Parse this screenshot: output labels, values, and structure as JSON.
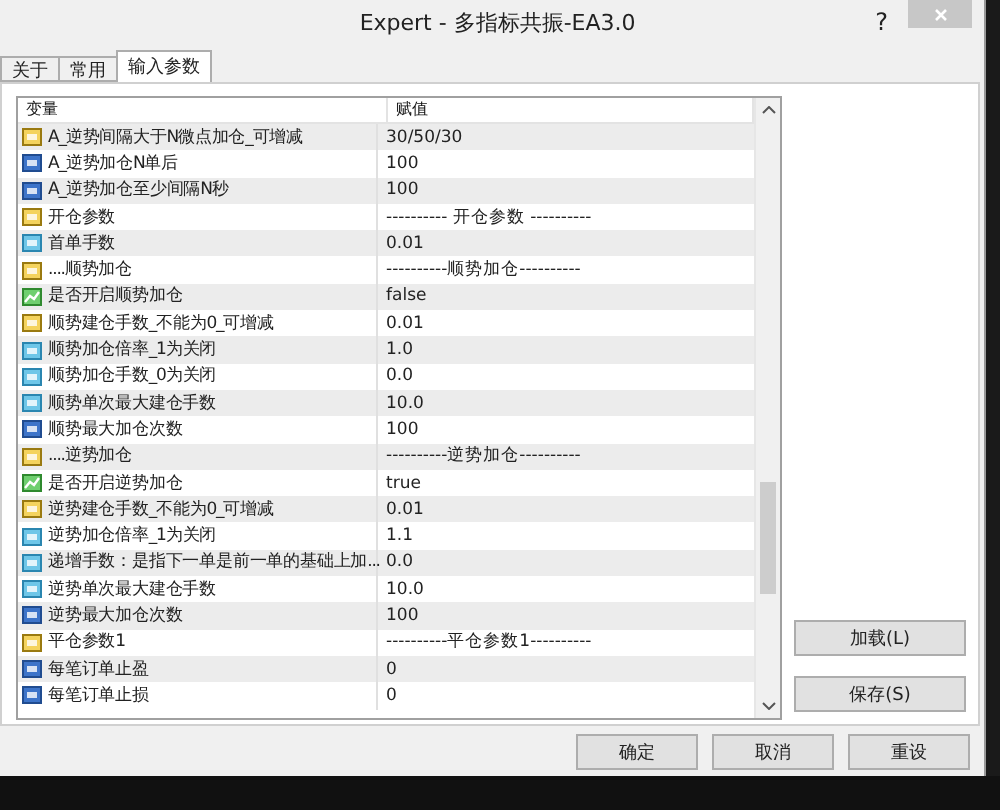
{
  "window": {
    "title": "Expert - 多指标共振-EA3.0",
    "help": "?"
  },
  "tabs": [
    {
      "label": "关于",
      "selected": false
    },
    {
      "label": "常用",
      "selected": false
    },
    {
      "label": "输入参数",
      "selected": true
    }
  ],
  "table": {
    "columns": [
      "变量",
      "赋值"
    ],
    "rows": [
      {
        "kind": "string",
        "name": "A_逆势间隔大于N微点加仓_可增减",
        "value": "30/50/30"
      },
      {
        "kind": "int",
        "name": "A_逆势加仓N单后",
        "value": "100"
      },
      {
        "kind": "int",
        "name": "A_逆势加仓至少间隔N秒",
        "value": "100"
      },
      {
        "kind": "string",
        "name": "开仓参数",
        "value": "---------- 开仓参数 ----------"
      },
      {
        "kind": "double",
        "name": "首单手数",
        "value": "0.01"
      },
      {
        "kind": "string",
        "name": "....顺势加仓",
        "value": "----------顺势加仓----------"
      },
      {
        "kind": "bool",
        "name": "是否开启顺势加仓",
        "value": "false"
      },
      {
        "kind": "string",
        "name": "顺势建仓手数_不能为0_可增减",
        "value": "0.01"
      },
      {
        "kind": "double",
        "name": "顺势加仓倍率_1为关闭",
        "value": "1.0"
      },
      {
        "kind": "double",
        "name": "顺势加仓手数_0为关闭",
        "value": "0.0"
      },
      {
        "kind": "double",
        "name": "顺势单次最大建仓手数",
        "value": "10.0"
      },
      {
        "kind": "int",
        "name": "顺势最大加仓次数",
        "value": "100"
      },
      {
        "kind": "string",
        "name": "....逆势加仓",
        "value": "----------逆势加仓----------"
      },
      {
        "kind": "bool",
        "name": "是否开启逆势加仓",
        "value": "true"
      },
      {
        "kind": "string",
        "name": "逆势建仓手数_不能为0_可增减",
        "value": "0.01"
      },
      {
        "kind": "double",
        "name": "逆势加仓倍率_1为关闭",
        "value": "1.1"
      },
      {
        "kind": "double",
        "name": "递增手数：是指下一单是前一单的基础上加...",
        "value": "0.0"
      },
      {
        "kind": "double",
        "name": "逆势单次最大建仓手数",
        "value": "10.0"
      },
      {
        "kind": "int",
        "name": "逆势最大加仓次数",
        "value": "100"
      },
      {
        "kind": "string",
        "name": "平仓参数1",
        "value": "----------平仓参数1----------"
      },
      {
        "kind": "int",
        "name": "每笔订单止盈",
        "value": "0"
      },
      {
        "kind": "int",
        "name": "每笔订单止损",
        "value": "0"
      }
    ]
  },
  "side_buttons": [
    "加载(L)",
    "保存(S)"
  ],
  "buttons": [
    "确定",
    "取消",
    "重设"
  ]
}
